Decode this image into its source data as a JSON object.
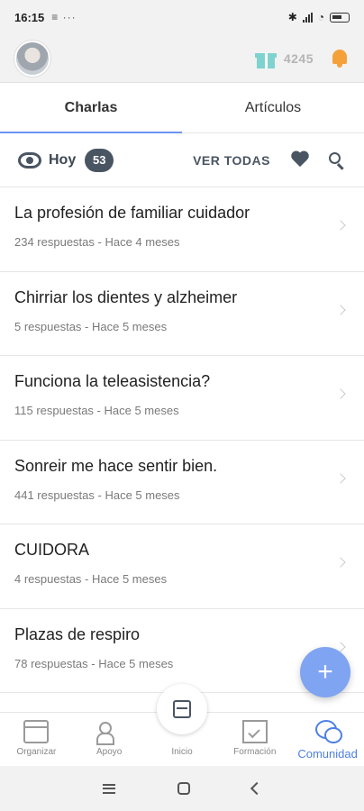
{
  "status_bar": {
    "time": "16:15",
    "notif_icons": "≡ ···"
  },
  "header": {
    "points": "4245"
  },
  "tabs": [
    {
      "label": "Charlas",
      "active": true
    },
    {
      "label": "Artículos",
      "active": false
    }
  ],
  "filter": {
    "label": "Hoy",
    "count": "53",
    "ver_todas": "VER TODAS"
  },
  "items": [
    {
      "title": "La profesión de familiar cuidador",
      "meta": "234 respuestas - Hace 4 meses"
    },
    {
      "title": "Chirriar los dientes y alzheimer",
      "meta": "5 respuestas - Hace 5 meses"
    },
    {
      "title": "Funciona la teleasistencia?",
      "meta": "115 respuestas - Hace 5 meses"
    },
    {
      "title": "Sonreir me hace sentir bien.",
      "meta": "441 respuestas - Hace 5 meses"
    },
    {
      "title": "CUIDORA",
      "meta": "4 respuestas - Hace 5 meses"
    },
    {
      "title": "Plazas de respiro",
      "meta": "78 respuestas - Hace 5 meses"
    }
  ],
  "fab": {
    "label": "+"
  },
  "bottom_nav": [
    {
      "label": "Organizar",
      "icon": "calendar-icon"
    },
    {
      "label": "Apoyo",
      "icon": "people-icon"
    },
    {
      "label": "Inicio",
      "icon": "inbox-icon"
    },
    {
      "label": "Formación",
      "icon": "whiteboard-icon"
    },
    {
      "label": "Comunidad",
      "icon": "chat-icon",
      "active": true
    }
  ],
  "colors": {
    "accent": "#6b93f0",
    "fab": "#7fa4f2",
    "gift": "#7fd3cf",
    "bell": "#f5a13a",
    "active_nav": "#4d7fe6"
  }
}
